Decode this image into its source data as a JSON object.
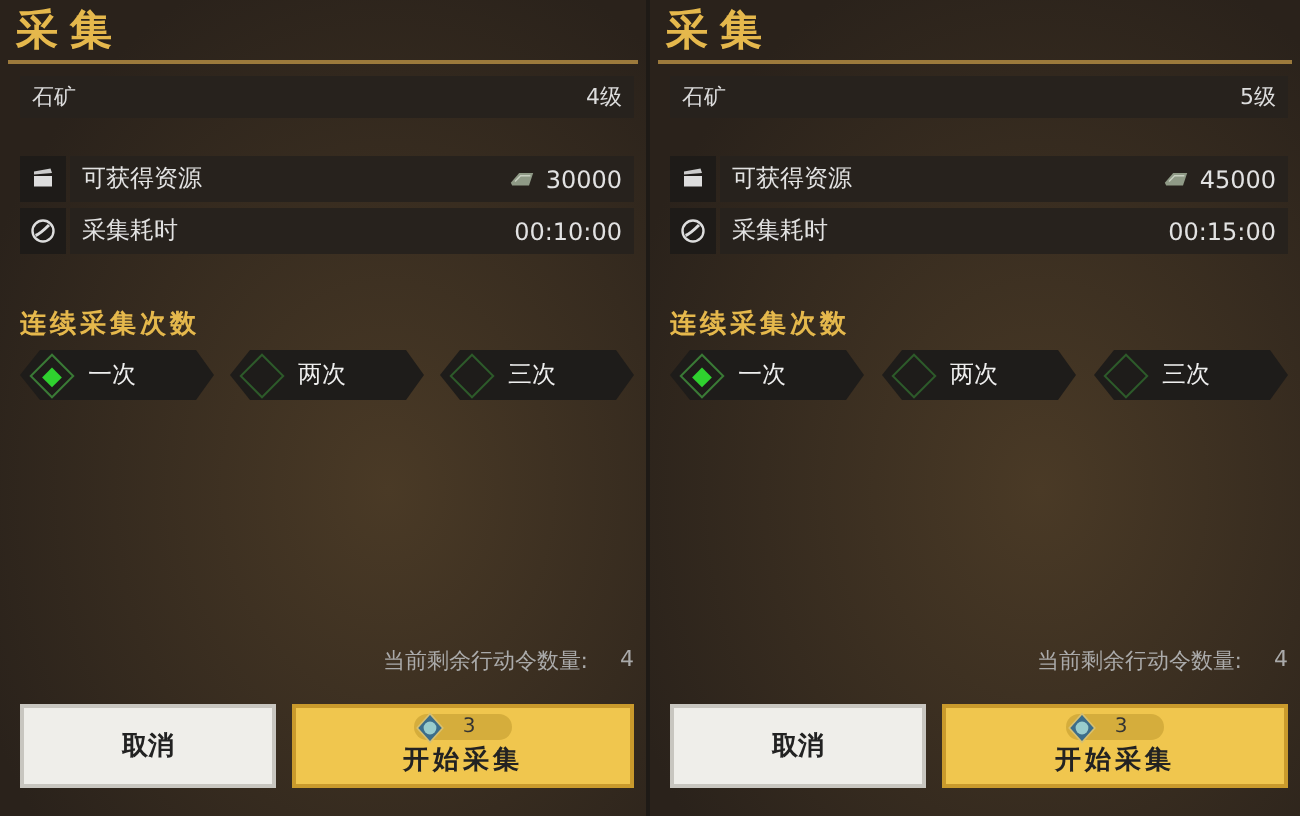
{
  "panels": [
    {
      "title": "采集",
      "target": {
        "name": "石矿",
        "level": "4级"
      },
      "stats": [
        {
          "kind": "resource",
          "label": "可获得资源",
          "value": "30000"
        },
        {
          "kind": "time",
          "label": "采集耗时",
          "value": "00:10:00"
        }
      ],
      "repeat_title": "连续采集次数",
      "options": [
        {
          "label": "一次",
          "selected": true
        },
        {
          "label": "两次",
          "selected": false
        },
        {
          "label": "三次",
          "selected": false
        }
      ],
      "remaining": {
        "label": "当前剩余行动令数量:",
        "value": "4"
      },
      "cancel": "取消",
      "start": {
        "label": "开始采集",
        "cost": "3"
      }
    },
    {
      "title": "采集",
      "target": {
        "name": "石矿",
        "level": "5级"
      },
      "stats": [
        {
          "kind": "resource",
          "label": "可获得资源",
          "value": "45000"
        },
        {
          "kind": "time",
          "label": "采集耗时",
          "value": "00:15:00"
        }
      ],
      "repeat_title": "连续采集次数",
      "options": [
        {
          "label": "一次",
          "selected": true
        },
        {
          "label": "两次",
          "selected": false
        },
        {
          "label": "三次",
          "selected": false
        }
      ],
      "remaining": {
        "label": "当前剩余行动令数量:",
        "value": "4"
      },
      "cancel": "取消",
      "start": {
        "label": "开始采集",
        "cost": "3"
      }
    }
  ]
}
